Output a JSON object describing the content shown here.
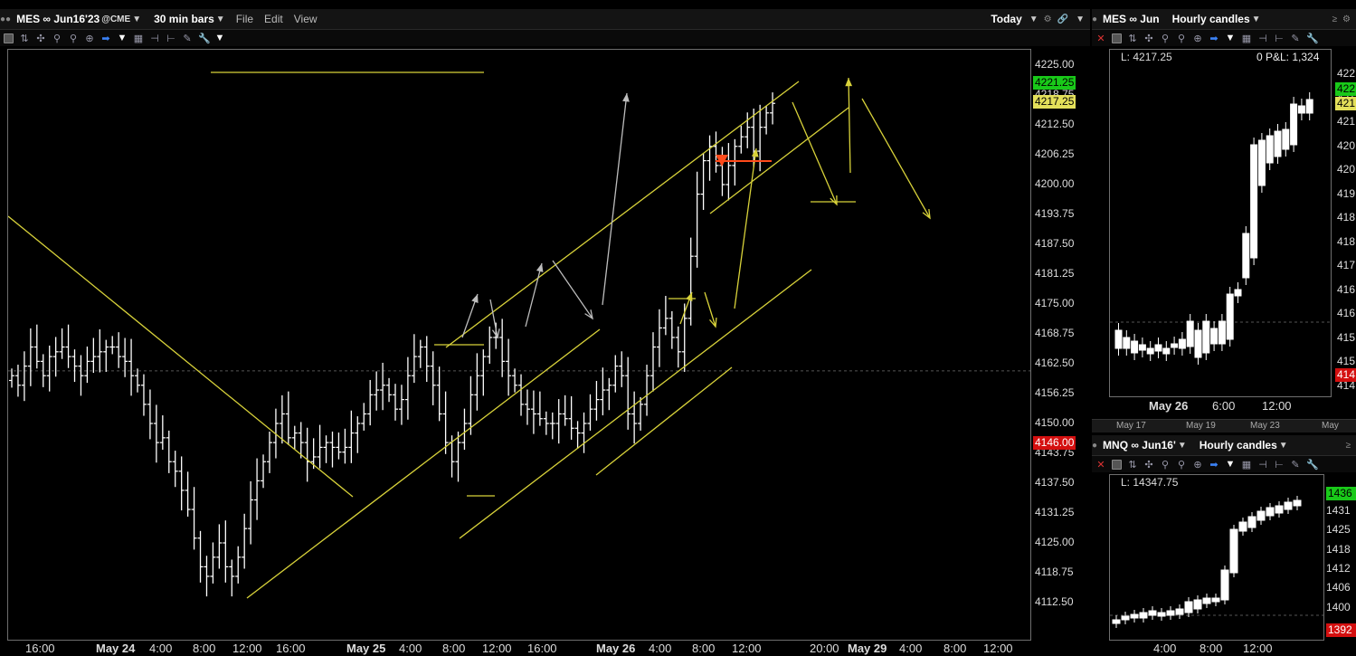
{
  "main": {
    "symbol": "MES ∞ Jun16'23",
    "exchange": "@CME",
    "timeframe": "30 min bars",
    "menus": [
      "File",
      "Edit",
      "View"
    ],
    "range_label": "Today",
    "y_ticks": [
      "4225.00",
      "4218.75",
      "4212.50",
      "4206.25",
      "4200.00",
      "4193.75",
      "4187.50",
      "4181.25",
      "4175.00",
      "4168.75",
      "4162.50",
      "4156.25",
      "4150.00",
      "4143.75",
      "4137.50",
      "4131.25",
      "4125.00",
      "4118.75",
      "4112.50"
    ],
    "price_tags": {
      "bid": "4221.25",
      "last": "4217.25",
      "low_ref": "4146.00"
    },
    "x_labels": [
      "16:00",
      "May 24",
      "4:00",
      "8:00",
      "12:00",
      "16:00",
      "May 25",
      "4:00",
      "8:00",
      "12:00",
      "16:00",
      "May 26",
      "4:00",
      "8:00",
      "12:00",
      "20:00",
      "May 29",
      "4:00",
      "8:00",
      "12:00"
    ],
    "colors": {
      "trendline": "#d8d23a",
      "arrow_gray": "#bdbdbd",
      "entry": "#ff4a1a",
      "bid_tag": "#19c919",
      "last_tag": "#e3e05a",
      "low_tag": "#d40f0f"
    }
  },
  "side_top": {
    "symbol": "MES ∞ Jun",
    "timeframe": "Hourly candles",
    "last": "L: 4217.25",
    "position": "0",
    "pnl": "P&L: 1,324",
    "y_ticks": [
      "422",
      "421",
      "421",
      "420",
      "420",
      "419",
      "418",
      "418",
      "417",
      "416",
      "416",
      "415",
      "415",
      "414"
    ],
    "tags": {
      "bid": "422",
      "last": "421",
      "low": "414"
    },
    "x_labels": [
      "May 26",
      "6:00",
      "12:00"
    ],
    "nav_labels": [
      "May 17",
      "May 19",
      "May 23",
      "May"
    ]
  },
  "side_bottom": {
    "symbol": "MNQ ∞ Jun16'",
    "timeframe": "Hourly candles",
    "last": "L: 14347.75",
    "y_ticks": [
      "1431",
      "1425",
      "1418",
      "1412",
      "1406",
      "1400"
    ],
    "tags": {
      "bid": "1436",
      "low": "1392"
    },
    "x_labels": [
      "4:00",
      "8:00",
      "12:00"
    ]
  }
}
